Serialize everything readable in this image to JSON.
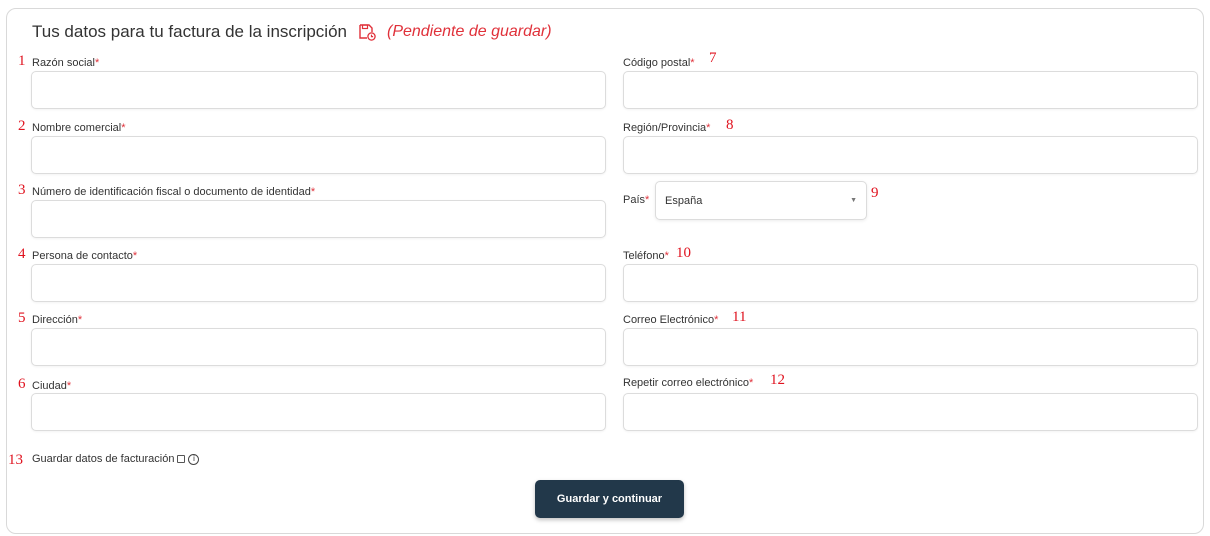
{
  "header": {
    "title": "Tus datos para tu factura de la inscripción",
    "status": "(Pendiente de guardar)"
  },
  "left_fields": [
    {
      "num": "1",
      "label": "Razón social",
      "required": "*",
      "value": ""
    },
    {
      "num": "2",
      "label": "Nombre comercial",
      "required": "*",
      "value": ""
    },
    {
      "num": "3",
      "label": "Número de identificación fiscal o documento de identidad",
      "required": "*",
      "value": ""
    },
    {
      "num": "4",
      "label": "Persona de contacto",
      "required": "*",
      "value": ""
    },
    {
      "num": "5",
      "label": "Dirección",
      "required": "*",
      "value": ""
    },
    {
      "num": "6",
      "label": "Ciudad",
      "required": "*",
      "value": ""
    }
  ],
  "right_fields": [
    {
      "num": "7",
      "label": "Código postal",
      "required": "*",
      "value": ""
    },
    {
      "num": "8",
      "label": "Región/Provincia",
      "required": "*",
      "value": ""
    },
    {
      "num": "9",
      "label": "País",
      "required": "*",
      "value": "España"
    },
    {
      "num": "10",
      "label": "Teléfono",
      "required": "*",
      "value": ""
    },
    {
      "num": "11",
      "label": "Correo Electrónico",
      "required": "*",
      "value": ""
    },
    {
      "num": "12",
      "label": "Repetir correo electrónico",
      "required": "*",
      "value": ""
    }
  ],
  "save_billing": {
    "num": "13",
    "label": "Guardar datos de facturación",
    "checked": false,
    "info_icon": "i"
  },
  "submit_button": "Guardar y continuar",
  "colors": {
    "accent_red": "#e0313a",
    "button_bg": "#22384a"
  }
}
